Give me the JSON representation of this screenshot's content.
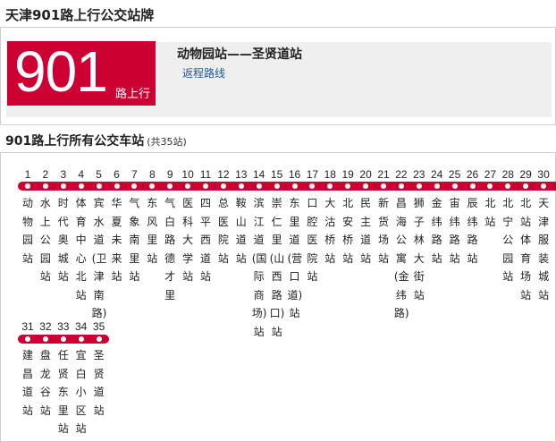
{
  "page_title": "天津901路上行公交站牌",
  "sign": {
    "route_number": "901",
    "direction": "路上行",
    "span": "动物园站——圣贤道站",
    "return_link": "返程路线"
  },
  "stops_section": {
    "title": "901路上行所有公交车站",
    "count_label": "(共35站)"
  },
  "colors": {
    "accent": "#cc0033",
    "link": "#1a5aa6"
  },
  "stops": [
    {
      "num": "1",
      "name": "动物园站"
    },
    {
      "num": "2",
      "name": "水上公园站"
    },
    {
      "num": "3",
      "name": "时代奥城站"
    },
    {
      "num": "4",
      "name": "体育中心北站"
    },
    {
      "num": "5",
      "name": "宾水道(卫津南路)"
    },
    {
      "num": "6",
      "name": "华夏未来站"
    },
    {
      "num": "7",
      "name": "气象南里站"
    },
    {
      "num": "8",
      "name": "东风里站"
    },
    {
      "num": "9",
      "name": "气白路德才里"
    },
    {
      "num": "10",
      "name": "医科大学站"
    },
    {
      "num": "11",
      "name": "四平西道站"
    },
    {
      "num": "12",
      "name": "总医院站"
    },
    {
      "num": "13",
      "name": "鞍山道站"
    },
    {
      "num": "14",
      "name": "滨江道(国际商场)站"
    },
    {
      "num": "15",
      "name": "崇仁里(山西路口)站"
    },
    {
      "num": "16",
      "name": "东里道(营口道)站"
    },
    {
      "num": "17",
      "name": "口腔医院站"
    },
    {
      "num": "18",
      "name": "大沽桥站"
    },
    {
      "num": "19",
      "name": "北安桥站"
    },
    {
      "num": "20",
      "name": "民主道站"
    },
    {
      "num": "21",
      "name": "新货场站"
    },
    {
      "num": "22",
      "name": "昌海公寓(金纬路)"
    },
    {
      "num": "23",
      "name": "狮子林大街站"
    },
    {
      "num": "24",
      "name": "金纬路站"
    },
    {
      "num": "25",
      "name": "宙纬路站"
    },
    {
      "num": "26",
      "name": "辰纬路站"
    },
    {
      "num": "27",
      "name": "北站"
    },
    {
      "num": "28",
      "name": "北宁公园站"
    },
    {
      "num": "29",
      "name": "北站体育场站"
    },
    {
      "num": "30",
      "name": "天津服装城站"
    },
    {
      "num": "31",
      "name": "建昌道站"
    },
    {
      "num": "32",
      "name": "盘龙谷站"
    },
    {
      "num": "33",
      "name": "任贤东里站"
    },
    {
      "num": "34",
      "name": "宜白小区站"
    },
    {
      "num": "35",
      "name": "圣贤道站"
    }
  ]
}
